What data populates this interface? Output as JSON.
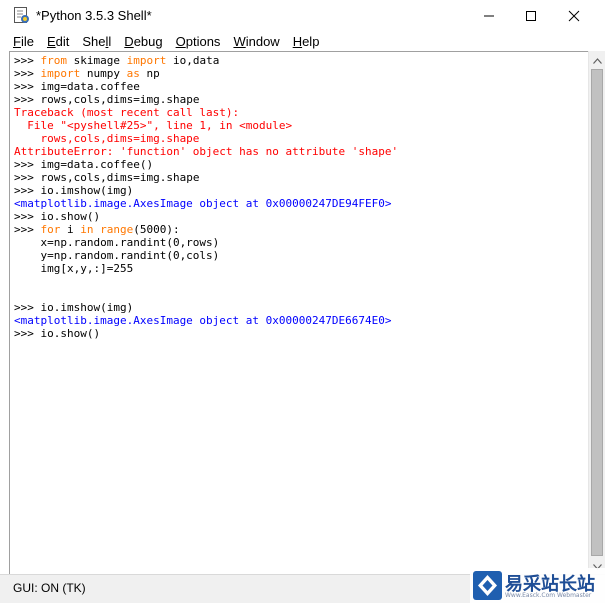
{
  "window": {
    "title": "*Python 3.5.3 Shell*",
    "icon": "python-idle-icon",
    "controls": {
      "minimize": "minimize-icon",
      "maximize": "maximize-icon",
      "close": "close-icon"
    }
  },
  "menu": {
    "items": [
      {
        "label": "File",
        "mnemonic": "F",
        "rest": "ile"
      },
      {
        "label": "Edit",
        "mnemonic": "E",
        "rest": "dit"
      },
      {
        "label": "Shell",
        "mnemonic": "S",
        "pre": "She",
        "mid": "l",
        "post": "l"
      },
      {
        "label": "Debug",
        "mnemonic": "D",
        "rest": "ebug"
      },
      {
        "label": "Options",
        "mnemonic": "O",
        "rest": "ptions"
      },
      {
        "label": "Window",
        "mnemonic": "W",
        "rest": "indow"
      },
      {
        "label": "Help",
        "mnemonic": "H",
        "rest": "elp"
      }
    ]
  },
  "shell": {
    "lines": [
      [
        {
          "t": ">>> ",
          "c": "prompt"
        },
        {
          "t": "from",
          "c": "kw"
        },
        {
          "t": " skimage ",
          "c": "code"
        },
        {
          "t": "import",
          "c": "kw"
        },
        {
          "t": " io,data",
          "c": "code"
        }
      ],
      [
        {
          "t": ">>> ",
          "c": "prompt"
        },
        {
          "t": "import",
          "c": "kw"
        },
        {
          "t": " numpy ",
          "c": "code"
        },
        {
          "t": "as",
          "c": "kw"
        },
        {
          "t": " np",
          "c": "code"
        }
      ],
      [
        {
          "t": ">>> ",
          "c": "prompt"
        },
        {
          "t": "img=data.coffee",
          "c": "code"
        }
      ],
      [
        {
          "t": ">>> ",
          "c": "prompt"
        },
        {
          "t": "rows,cols,dims=img.shape",
          "c": "code"
        }
      ],
      [
        {
          "t": "Traceback (most recent call last):",
          "c": "err"
        }
      ],
      [
        {
          "t": "  File \"<pyshell#25>\", line 1, in <module>",
          "c": "err"
        }
      ],
      [
        {
          "t": "    rows,cols,dims=img.shape",
          "c": "err"
        }
      ],
      [
        {
          "t": "AttributeError: 'function' object has no attribute 'shape'",
          "c": "err"
        }
      ],
      [
        {
          "t": ">>> ",
          "c": "prompt"
        },
        {
          "t": "img=data.coffee()",
          "c": "code"
        }
      ],
      [
        {
          "t": ">>> ",
          "c": "prompt"
        },
        {
          "t": "rows,cols,dims=img.shape",
          "c": "code"
        }
      ],
      [
        {
          "t": ">>> ",
          "c": "prompt"
        },
        {
          "t": "io.imshow(img)",
          "c": "code"
        }
      ],
      [
        {
          "t": "<matplotlib.image.AxesImage object at 0x00000247DE94FEF0>",
          "c": "out"
        }
      ],
      [
        {
          "t": ">>> ",
          "c": "prompt"
        },
        {
          "t": "io.show()",
          "c": "code"
        }
      ],
      [
        {
          "t": ">>> ",
          "c": "prompt"
        },
        {
          "t": "for",
          "c": "kw"
        },
        {
          "t": " i ",
          "c": "code"
        },
        {
          "t": "in",
          "c": "kw"
        },
        {
          "t": " ",
          "c": "code"
        },
        {
          "t": "range",
          "c": "kw"
        },
        {
          "t": "(5000):",
          "c": "code"
        }
      ],
      [
        {
          "t": "    x=np.random.randint(0,rows)",
          "c": "code"
        }
      ],
      [
        {
          "t": "    y=np.random.randint(0,cols)",
          "c": "code"
        }
      ],
      [
        {
          "t": "    img[x,y,:]=255",
          "c": "code"
        }
      ],
      [],
      [],
      [
        {
          "t": ">>> ",
          "c": "prompt"
        },
        {
          "t": "io.imshow(img)",
          "c": "code"
        }
      ],
      [
        {
          "t": "<matplotlib.image.AxesImage object at 0x00000247DE6674E0>",
          "c": "out"
        }
      ],
      [
        {
          "t": ">>> ",
          "c": "prompt"
        },
        {
          "t": "io.show()",
          "c": "code"
        }
      ]
    ]
  },
  "status": {
    "text": "GUI: ON (TK)"
  },
  "watermark": {
    "text": "易采站长站",
    "sub": "Www.Easck.Com Webmaster",
    "logo": "easck-logo-icon"
  },
  "colors": {
    "keyword": "#ff7700",
    "error": "#ff0000",
    "output": "#0000ff",
    "code": "#000000",
    "watermark": "#1f4e96"
  }
}
